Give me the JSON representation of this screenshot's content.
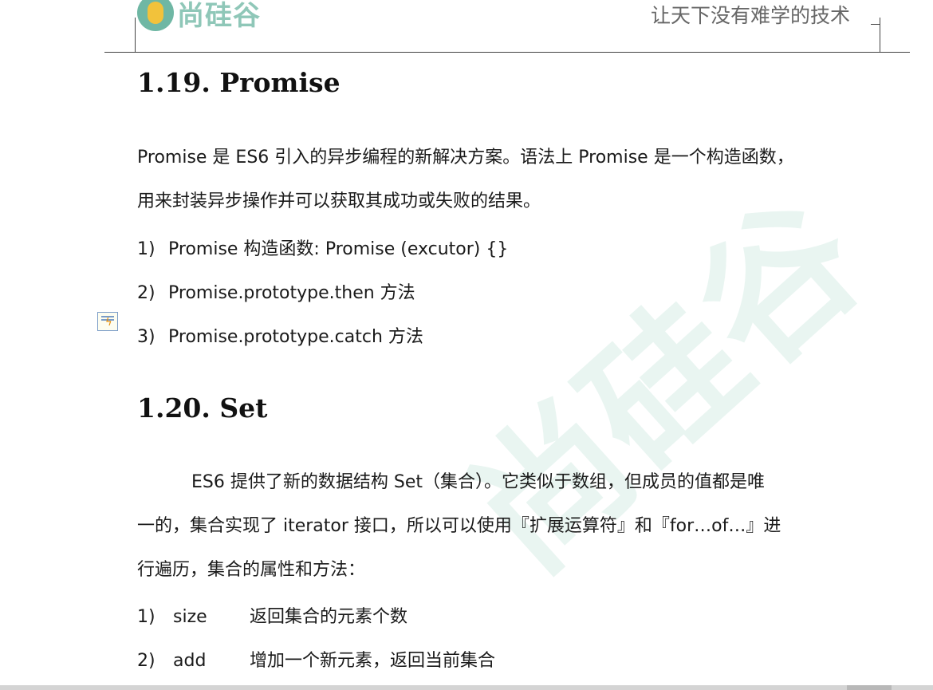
{
  "header": {
    "logo_text": "尚硅谷",
    "slogan": "让天下没有难学的技术"
  },
  "watermark_text": "尚硅谷",
  "sections": [
    {
      "heading": "1.19. Promise",
      "paragraph_lines": [
        "Promise 是 ES6 引入的异步编程的新解决方案。语法上 Promise 是一个构造函数，",
        "用来封装异步操作并可以获取其成功或失败的结果。"
      ],
      "items": [
        {
          "num": "1)",
          "text": "Promise 构造函数: Promise (excutor) {}"
        },
        {
          "num": "2)",
          "text": "Promise.prototype.then 方法"
        },
        {
          "num": "3)",
          "text": "Promise.prototype.catch 方法"
        }
      ]
    },
    {
      "heading": "1.20. Set",
      "paragraph_lines": [
        "ES6 提供了新的数据结构 Set（集合）。它类似于数组，但成员的值都是唯",
        "一的，集合实现了 iterator 接口，所以可以使用『扩展运算符』和『for…of…』进",
        "行遍历，集合的属性和方法："
      ],
      "items": [
        {
          "num": "1)",
          "term": "size",
          "text": "返回集合的元素个数"
        },
        {
          "num": "2)",
          "term": "add",
          "text": "增加一个新元素，返回当前集合"
        }
      ]
    }
  ],
  "colors": {
    "logo_green": "#6fb7a4",
    "logo_yellow": "#f2c23b",
    "watermark": "#e9f5f1"
  },
  "icons": {
    "comment_marker": "comment-bolt-icon"
  }
}
